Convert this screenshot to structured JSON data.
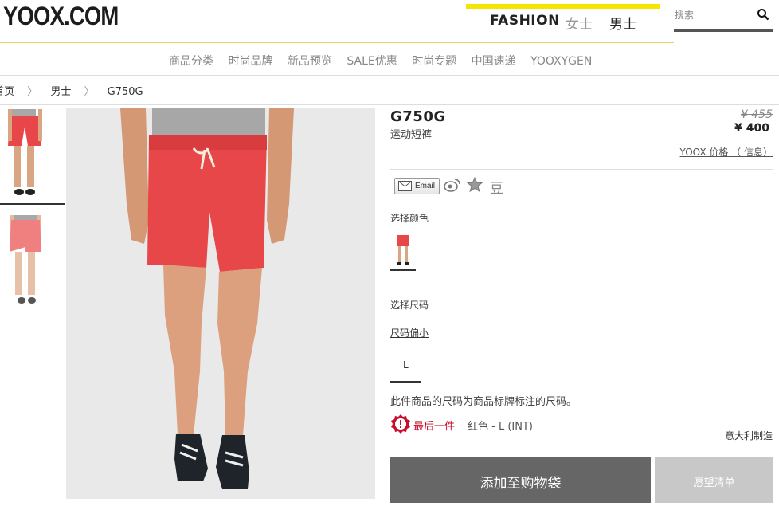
{
  "header": {
    "logo": "YOOX.COM",
    "tabs": [
      "FASHION",
      "女士",
      "男士"
    ],
    "search_placeholder": "搜索"
  },
  "nav": {
    "items": [
      "商品分类",
      "时尚品牌",
      "新品预览",
      "SALE优惠",
      "时尚专题",
      "中国速递",
      "YOOXYGEN"
    ]
  },
  "breadcrumb": {
    "items": [
      "首页",
      "男士",
      "G750G"
    ]
  },
  "product": {
    "name": "G750G",
    "category": "运动短裤",
    "old_price": "¥ 455",
    "price": "¥ 400",
    "yoox_price_link": "YOOX 价格 （ 信息）",
    "share_email": "Email",
    "share_douban": "豆",
    "color_label": "选择颜色",
    "size_label": "选择尺码",
    "size_fit_link": "尺码偏小",
    "size_option": "L",
    "size_note": "此件商品的尺码为商品标牌标注的尺码。",
    "last_one": "最后一件",
    "variant": "红色 - L (INT)",
    "origin": "意大利制造",
    "add_to_bag": "添加至购物袋",
    "wishlist": "愿望清单"
  },
  "colors": {
    "accent_yellow": "#f5e600",
    "shorts_red": "#e8474a",
    "button_dark": "#666666",
    "button_light": "#c8c8c8",
    "alert_red": "#c8102e"
  }
}
